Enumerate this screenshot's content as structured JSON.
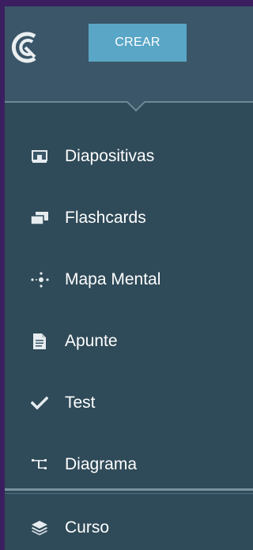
{
  "header": {
    "create_label": "CREAR"
  },
  "menu": {
    "items": [
      {
        "label": "Diapositivas",
        "icon": "slides-icon"
      },
      {
        "label": "Flashcards",
        "icon": "flashcards-icon"
      },
      {
        "label": "Mapa Mental",
        "icon": "mind-map-icon"
      },
      {
        "label": "Apunte",
        "icon": "note-icon"
      },
      {
        "label": "Test",
        "icon": "checkmark-icon"
      },
      {
        "label": "Diagrama",
        "icon": "diagram-icon"
      }
    ],
    "footer_item": {
      "label": "Curso",
      "icon": "course-stack-icon"
    }
  },
  "colors": {
    "background_frame": "#3b1e60",
    "header_bg": "#3a5668",
    "menu_bg": "#2f4a58",
    "button_bg": "#5aa6c6",
    "text": "#ffffff"
  }
}
